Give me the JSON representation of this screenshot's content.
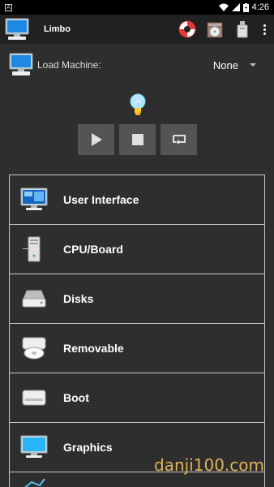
{
  "status_bar": {
    "notification": "A",
    "time": "4:26"
  },
  "app_bar": {
    "title": "Limbo"
  },
  "machine": {
    "label": "Load Machine:",
    "value": "None"
  },
  "menu": {
    "items": [
      {
        "label": "User Interface",
        "icon": "monitor-icon"
      },
      {
        "label": "CPU/Board",
        "icon": "tower-icon"
      },
      {
        "label": "Disks",
        "icon": "hard-disk-icon"
      },
      {
        "label": "Removable",
        "icon": "cdrom-drive-icon"
      },
      {
        "label": "Boot",
        "icon": "boot-drive-icon"
      },
      {
        "label": "Graphics",
        "icon": "display-icon"
      }
    ]
  },
  "watermark": "danji100.com",
  "colors": {
    "background": "#2e2e2e",
    "app_bar": "#212121",
    "button": "#545454",
    "border": "#c8c8c8"
  }
}
